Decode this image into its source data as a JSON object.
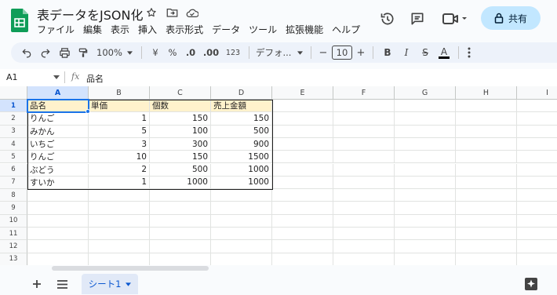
{
  "app": {
    "doc_title": "表データをJSON化",
    "menu": [
      "ファイル",
      "編集",
      "表示",
      "挿入",
      "表示形式",
      "データ",
      "ツール",
      "拡張機能",
      "ヘルプ"
    ],
    "share_label": "共有"
  },
  "toolbar": {
    "zoom": "100%",
    "currency": "¥",
    "percent": "%",
    "dec_decrease": ".0",
    "dec_increase": ".00",
    "number_format": "123",
    "font": "デフォ...",
    "font_size": "10",
    "bold": "B",
    "italic": "I",
    "strike": "S",
    "text_color": "A",
    "minus": "−",
    "plus": "+"
  },
  "formula_bar": {
    "name_box": "A1",
    "fx": "fx",
    "content": "品名"
  },
  "grid": {
    "columns": [
      "A",
      "B",
      "C",
      "D",
      "E",
      "F",
      "G",
      "H",
      "I"
    ],
    "rows": [
      "1",
      "2",
      "3",
      "4",
      "5",
      "6",
      "7",
      "8",
      "9",
      "10",
      "11",
      "12",
      "13"
    ],
    "header_row": [
      "品名",
      "単価",
      "個数",
      "売上金額"
    ],
    "data_rows": [
      [
        "りんご",
        "1",
        "150",
        "150"
      ],
      [
        "みかん",
        "5",
        "100",
        "500"
      ],
      [
        "いちご",
        "3",
        "300",
        "900"
      ],
      [
        "りんご",
        "10",
        "150",
        "1500"
      ],
      [
        "ぶどう",
        "2",
        "500",
        "1000"
      ],
      [
        "すいか",
        "1",
        "1000",
        "1000"
      ]
    ],
    "selected_cell": "A1",
    "header_fill_color": "#fff2cc",
    "selection_color": "#1a73e8"
  },
  "sheets": {
    "tabs": [
      {
        "label": "シート1"
      }
    ]
  },
  "colors": {
    "share_bg": "#c2e7ff",
    "toolbar_bg": "#edf2fa",
    "brand_green": "#0f9d58"
  }
}
